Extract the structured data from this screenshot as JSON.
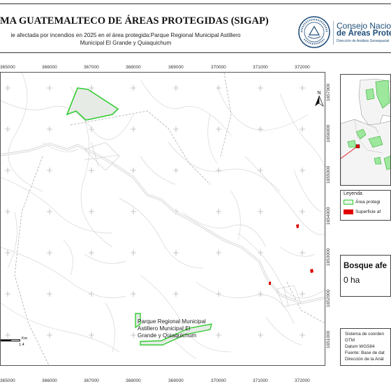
{
  "header": {
    "title": "MA GUATEMALTECO DE ÁREAS PROTEGIDAS  (SIGAP)",
    "subtitle_line1": "ie afectada por incendios en 2025 en el área protegida:Parque Regional Municipal Astillero",
    "subtitle_line2": "Municipal El Grande y  Quiaquichum"
  },
  "org": {
    "name_line1": "Consejo Nacional",
    "name_line2": "de Áreas Protegid",
    "name_line3": "Dirección de Análisis Geoespacial",
    "seal_text_top": "GOBIERNO DE LA REPÚBLICA",
    "seal_text_bottom": "GUATEMALA"
  },
  "map": {
    "x_ticks": [
      "365000",
      "366000",
      "367000",
      "368000",
      "369000",
      "370000",
      "371000",
      "372000"
    ],
    "y_ticks": [
      "1657000",
      "1656000",
      "1655000",
      "1654000",
      "1653000",
      "1652000",
      "1651000"
    ],
    "area_label_line1": "Parque Regional Municipal",
    "area_label_line2": "Astillero Municipal El",
    "area_label_line3": "Grande y Quiaquichum",
    "scale_unit": "Km",
    "scale_value": "1.4",
    "north_label": "N"
  },
  "legend": {
    "title": "Leyenda",
    "items": [
      {
        "label": "Área protegi",
        "color": "#33cc33"
      },
      {
        "label": "Superficie af",
        "color": "#e00000"
      }
    ]
  },
  "burned": {
    "title": "Bosque afe",
    "value": "0 ha"
  },
  "metadata": {
    "line1": "Sistema de coorden",
    "line2": "GTM",
    "line3": "Datum WGS84",
    "line4": "Fuente: Base de dat",
    "line5": "Dirección de la Anál"
  },
  "colors": {
    "protected_area": "#33cc33",
    "fire_surface": "#e00000",
    "org_blue": "#1f4e79"
  }
}
